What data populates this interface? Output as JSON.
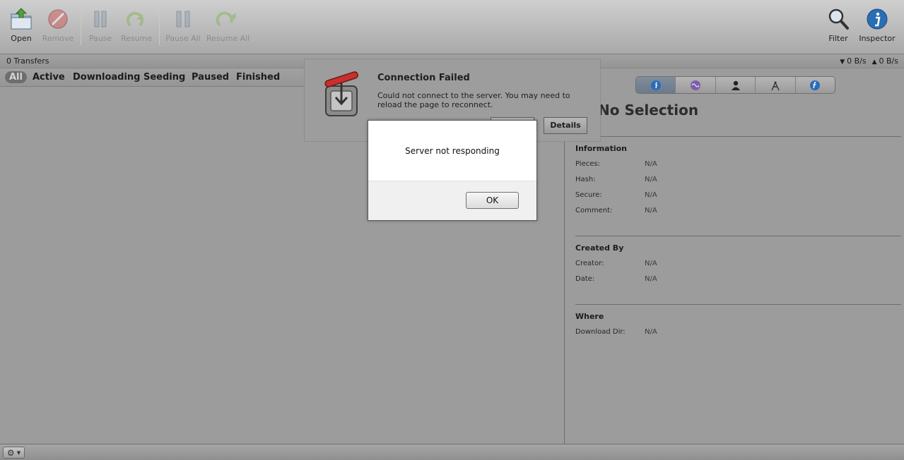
{
  "toolbar": {
    "open": "Open",
    "remove": "Remove",
    "pause": "Pause",
    "resume": "Resume",
    "pause_all": "Pause All",
    "resume_all": "Resume All",
    "filter": "Filter",
    "inspector": "Inspector"
  },
  "status": {
    "transfers": "0 Transfers",
    "download_speed": "0 B/s",
    "upload_speed": "0 B/s"
  },
  "filters": [
    "All",
    "Active",
    "Downloading",
    "Seeding",
    "Paused",
    "Finished"
  ],
  "filter_selected": "All",
  "inspector": {
    "title": "No Selection",
    "tabs": [
      "info-icon",
      "activity-icon",
      "peers-icon",
      "trackers-icon",
      "files-icon"
    ],
    "information": {
      "heading": "Information",
      "rows": [
        {
          "label": "Pieces:",
          "value": "N/A"
        },
        {
          "label": "Hash:",
          "value": "N/A"
        },
        {
          "label": "Secure:",
          "value": "N/A"
        },
        {
          "label": "Comment:",
          "value": "N/A"
        }
      ]
    },
    "created_by": {
      "heading": "Created By",
      "rows": [
        {
          "label": "Creator:",
          "value": "N/A"
        },
        {
          "label": "Date:",
          "value": "N/A"
        }
      ]
    },
    "where": {
      "heading": "Where",
      "rows": [
        {
          "label": "Download Dir:",
          "value": "N/A"
        }
      ]
    }
  },
  "connection_panel": {
    "title": "Connection Failed",
    "message": "Could not connect to the server. You may need to reload the page to reconnect.",
    "details_button": "Details"
  },
  "alert": {
    "message": "Server not responding",
    "ok_button": "OK"
  },
  "colors": {
    "selected_tab": "#6b7a8c",
    "info_blue": "#2a6db5"
  }
}
